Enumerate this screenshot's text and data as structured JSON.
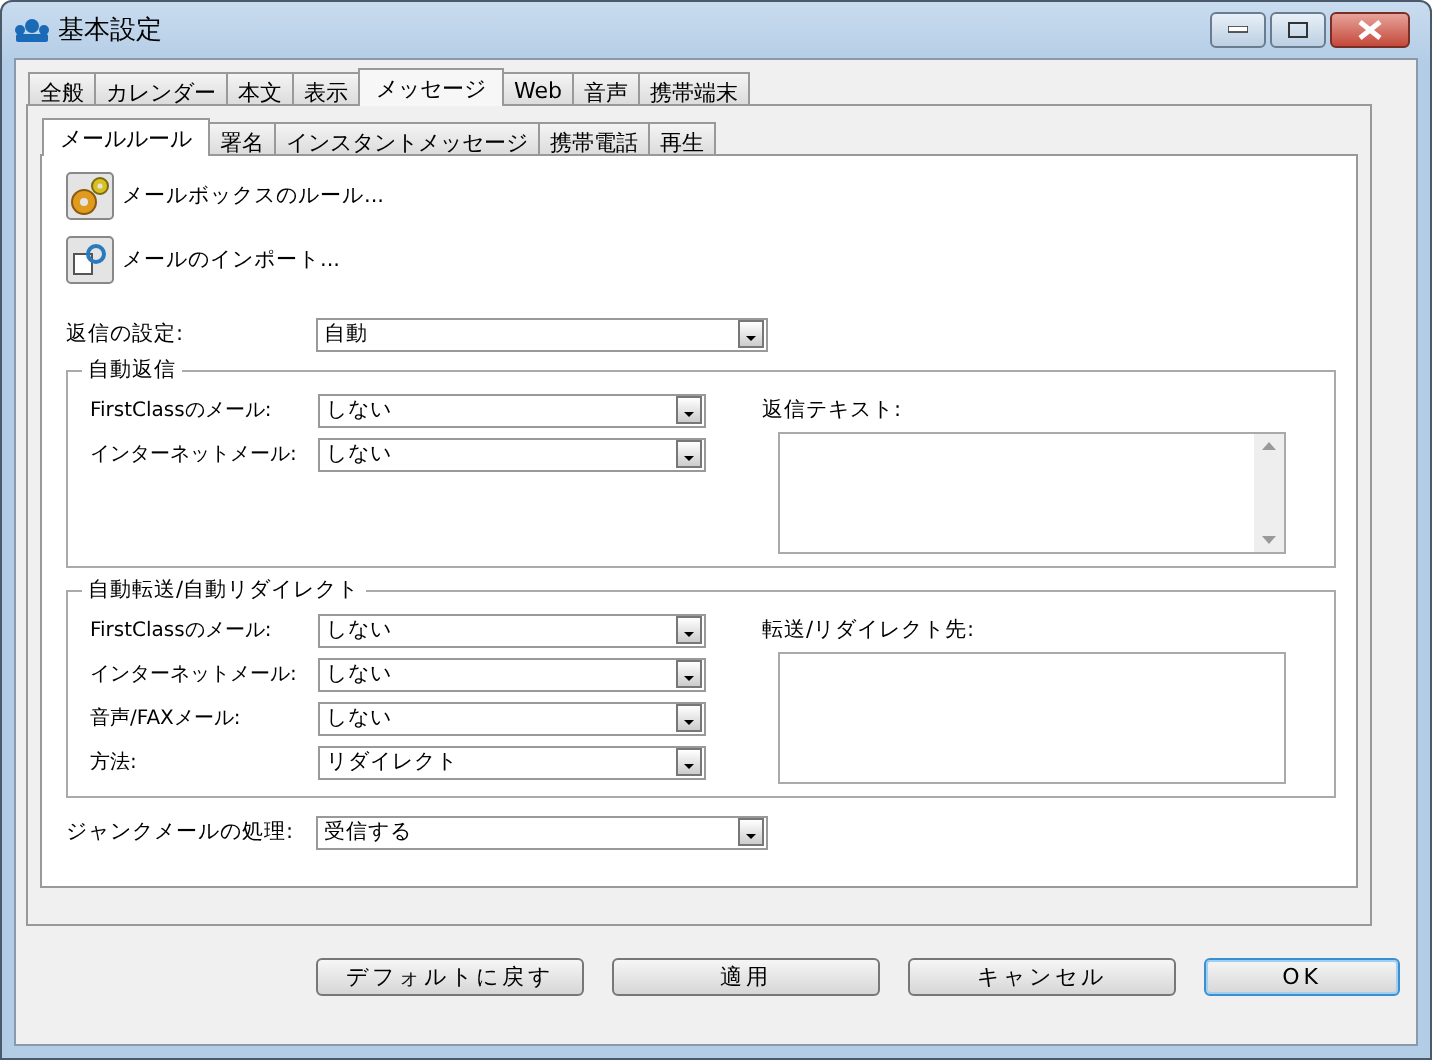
{
  "window": {
    "title": "基本設定"
  },
  "tabs": [
    {
      "label": "全般",
      "selected": false
    },
    {
      "label": "カレンダー",
      "selected": false
    },
    {
      "label": "本文",
      "selected": false
    },
    {
      "label": "表示",
      "selected": false
    },
    {
      "label": "メッセージ",
      "selected": true
    },
    {
      "label": "Web",
      "selected": false
    },
    {
      "label": "音声",
      "selected": false
    },
    {
      "label": "携帯端末",
      "selected": false
    }
  ],
  "subtabs": [
    {
      "label": "メールルール",
      "selected": true
    },
    {
      "label": "署名",
      "selected": false
    },
    {
      "label": "インスタントメッセージ",
      "selected": false
    },
    {
      "label": "携帯電話",
      "selected": false
    },
    {
      "label": "再生",
      "selected": false
    }
  ],
  "actions": [
    {
      "label": "メールボックスのルール...",
      "kind": "gears"
    },
    {
      "label": "メールのインポート...",
      "kind": "import"
    }
  ],
  "reply_setting": {
    "label": "返信の設定:",
    "value": "自動"
  },
  "groups": [
    {
      "title": "自動返信",
      "fields": [
        {
          "label": "FirstClassのメール:",
          "value": "しない"
        },
        {
          "label": "インターネットメール:",
          "value": "しない"
        }
      ],
      "text_label": "返信テキスト:",
      "scrollbar": true
    },
    {
      "title": "自動転送/自動リダイレクト",
      "fields": [
        {
          "label": "FirstClassのメール:",
          "value": "しない"
        },
        {
          "label": "インターネットメール:",
          "value": "しない"
        },
        {
          "label": "音声/FAXメール:",
          "value": "しない"
        },
        {
          "label": "方法:",
          "value": "リダイレクト"
        }
      ],
      "text_label": "転送/リダイレクト先:",
      "scrollbar": false
    }
  ],
  "junk": {
    "label": "ジャンクメールの処理:",
    "value": "受信する"
  },
  "buttons": [
    {
      "label": "デフォルトに戻す",
      "default": false
    },
    {
      "label": "適用",
      "default": false
    },
    {
      "label": "キャンセル",
      "default": false
    },
    {
      "label": "OK",
      "default": true
    }
  ]
}
